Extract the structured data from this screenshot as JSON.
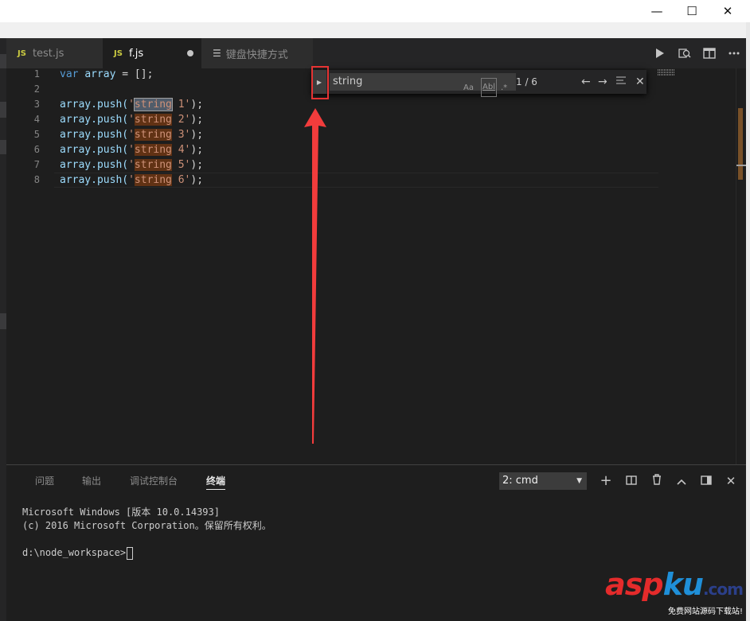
{
  "window": {
    "minimize": "—",
    "maximize": "☐",
    "close": "✕"
  },
  "tabs": [
    {
      "badge": "JS",
      "label": "test.js"
    },
    {
      "badge": "JS",
      "label": "f.js"
    },
    {
      "label": "键盘快捷方式"
    }
  ],
  "editor_actions": [
    "run-icon",
    "open-changes-icon",
    "split-editor-icon",
    "more-icon"
  ],
  "line_numbers": [
    "1",
    "2",
    "3",
    "4",
    "5",
    "6",
    "7",
    "8"
  ],
  "code": {
    "l1_kw": "var",
    "l1_var": "array",
    "l1_rest": " = [];",
    "push_prefix": "array.push(",
    "quote": "'",
    "match": "string",
    "push_suffix": ");",
    "nums": [
      "1",
      "2",
      "3",
      "4",
      "5",
      "6"
    ]
  },
  "find": {
    "query": "string",
    "case_label": "Aa",
    "word_label": "Abl",
    "regex_label": ".*",
    "count": "1 / 6"
  },
  "panel": {
    "tabs": [
      "问题",
      "输出",
      "调试控制台",
      "终端"
    ],
    "terminal_select": "2: cmd",
    "terminal_lines": [
      "Microsoft Windows [版本 10.0.14393]",
      "(c) 2016 Microsoft Corporation。保留所有权利。",
      "",
      "d:\\node_workspace>"
    ]
  },
  "watermark": {
    "part1": "asp",
    "part2": "ku",
    "part3": ".com",
    "sub": "免费网站源码下载站!"
  },
  "colors": {
    "accent_red": "#e53333",
    "match_bg": "#613214",
    "editor_bg": "#1e1e1e"
  }
}
